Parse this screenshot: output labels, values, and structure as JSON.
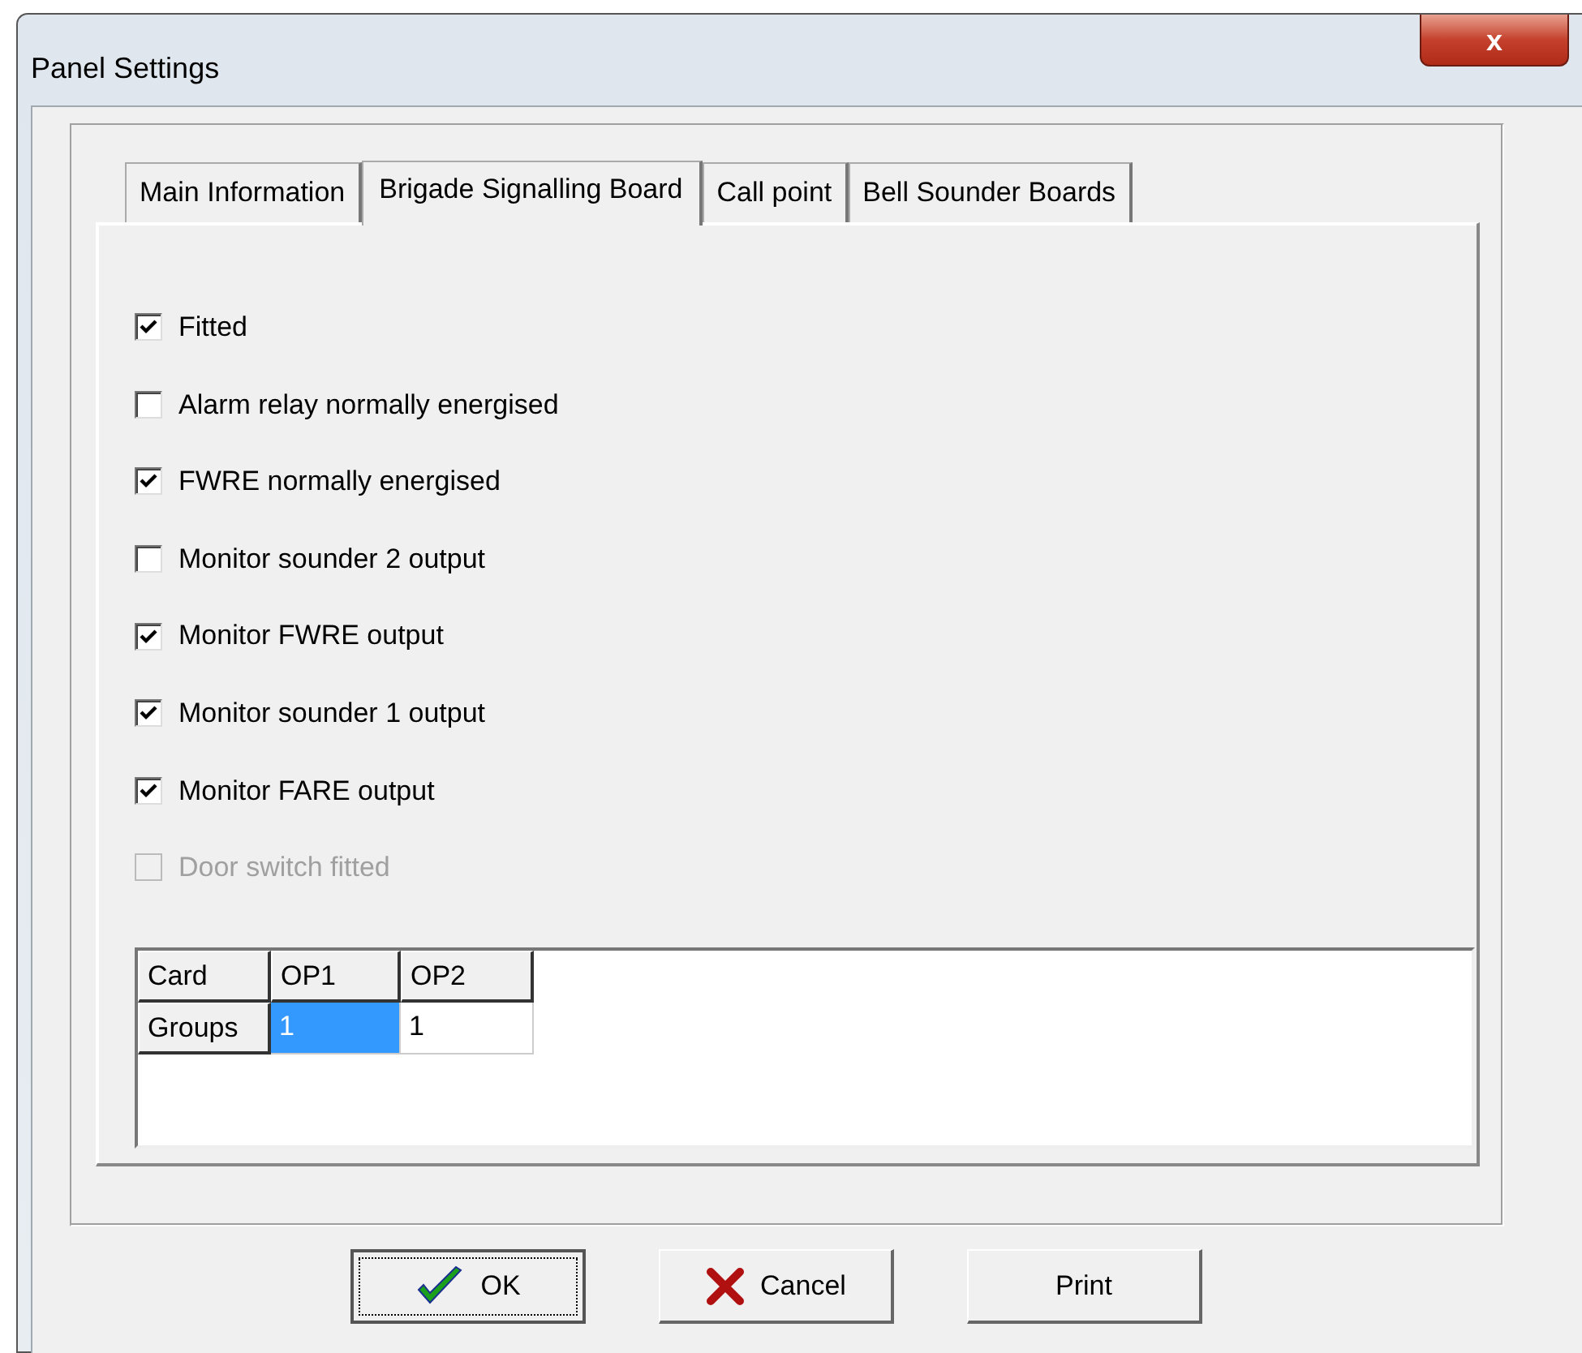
{
  "window": {
    "title": "Panel Settings",
    "close": "x"
  },
  "tabs": [
    {
      "label": "Main Information",
      "selected": false
    },
    {
      "label": "Brigade Signalling Board",
      "selected": true
    },
    {
      "label": "Call point",
      "selected": false
    },
    {
      "label": "Bell Sounder Boards",
      "selected": false
    }
  ],
  "options": [
    {
      "label": "Fitted",
      "checked": true,
      "disabled": false
    },
    {
      "label": "Alarm relay normally energised",
      "checked": false,
      "disabled": false
    },
    {
      "label": "FWRE normally energised",
      "checked": true,
      "disabled": false
    },
    {
      "label": "Monitor sounder 2 output",
      "checked": false,
      "disabled": false
    },
    {
      "label": "Monitor FWRE output",
      "checked": true,
      "disabled": false
    },
    {
      "label": "Monitor sounder 1 output",
      "checked": true,
      "disabled": false
    },
    {
      "label": "Monitor FARE output",
      "checked": true,
      "disabled": false
    },
    {
      "label": "Door switch fitted",
      "checked": false,
      "disabled": true
    }
  ],
  "grid": {
    "corner": "Card",
    "columns": [
      "OP1",
      "OP2"
    ],
    "rows": [
      {
        "header": "Groups",
        "cells": [
          {
            "text": "1",
            "selected": true
          },
          {
            "text": "1",
            "selected": false
          }
        ]
      }
    ]
  },
  "buttons": [
    {
      "label": "OK",
      "kind": "ok",
      "focused": true
    },
    {
      "label": "Cancel",
      "kind": "cancel",
      "focused": false
    },
    {
      "label": "Print",
      "kind": "plain",
      "focused": false
    }
  ]
}
